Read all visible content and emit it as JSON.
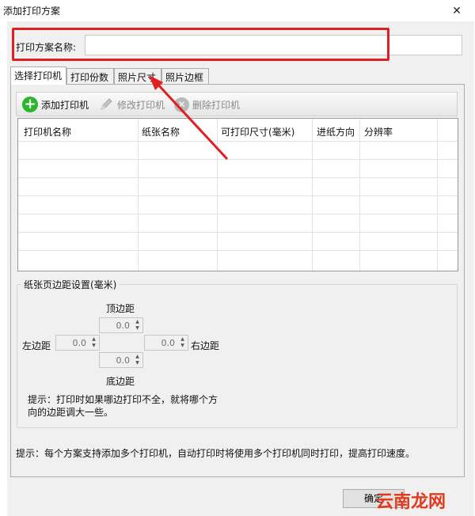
{
  "window": {
    "title": "添加打印方案",
    "close_symbol": "✕"
  },
  "name_field": {
    "label": "打印方案名称:",
    "value": ""
  },
  "tabs": [
    {
      "label": "选择打印机",
      "active": true
    },
    {
      "label": "打印份数",
      "active": false
    },
    {
      "label": "照片尺寸",
      "active": false
    },
    {
      "label": "照片边框",
      "active": false
    }
  ],
  "toolbar": {
    "add": {
      "label": "添加打印机",
      "icon": "plus-circle-icon",
      "enabled": true
    },
    "edit": {
      "label": "修改打印机",
      "icon": "pencil-icon",
      "enabled": false
    },
    "delete": {
      "label": "删除打印机",
      "icon": "delete-icon",
      "enabled": false
    }
  },
  "printer_table": {
    "columns": [
      "打印机名称",
      "纸张名称",
      "可打印尺寸(毫米)",
      "进纸方向",
      "分辨率"
    ],
    "rows": []
  },
  "margins": {
    "group_title": "纸张页边距设置(毫米)",
    "top": {
      "label": "顶边距",
      "value": "0.0"
    },
    "left": {
      "label": "左边距",
      "value": "0.0"
    },
    "right": {
      "label": "右边距",
      "value": "0.0"
    },
    "bottom": {
      "label": "底边距",
      "value": "0.0"
    },
    "tip": "提示：打印时如果哪边打印不全，就将哪个方向的边距调大一些。"
  },
  "bottom_tip": "提示：每个方案支持添加多个打印机，自动打印时将使用多个打印机同时打印，提高打印速度。",
  "buttons": {
    "ok": "确定"
  },
  "watermark": {
    "text": "云南龙网"
  },
  "colors": {
    "highlight": "#e02020",
    "add_icon": "#2db52d",
    "watermark": "#e23a1e"
  }
}
